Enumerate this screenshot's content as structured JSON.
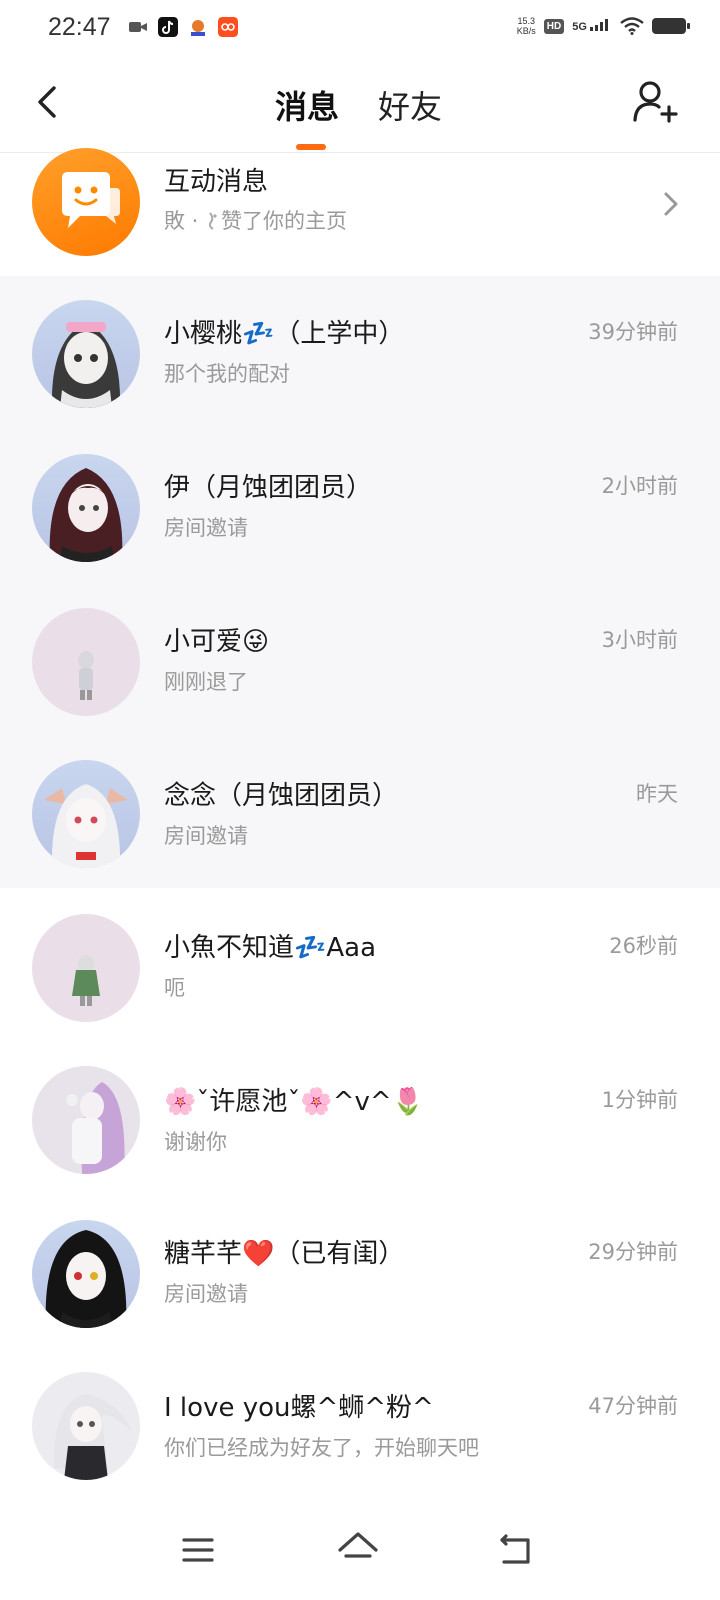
{
  "status_bar": {
    "time": "22:47",
    "net_speed_value": "15.3",
    "net_speed_unit": "KB/s",
    "hd": "HD",
    "network": "5G"
  },
  "header": {
    "tabs": [
      {
        "label": "消息",
        "active": true
      },
      {
        "label": "好友",
        "active": false
      }
    ],
    "accent_color": "#ff6a13"
  },
  "interaction": {
    "title": "互动消息",
    "preview_prefix": "敗 · ",
    "preview_suffix": "赞了你的主页"
  },
  "conversations": [
    {
      "name": "小樱桃💤（上学中）",
      "preview": "那个我的配对",
      "time": "39分钟前",
      "pinned": true
    },
    {
      "name": "伊（月蚀团团员）",
      "preview": "房间邀请",
      "time": "2小时前",
      "pinned": true
    },
    {
      "name": "小可爱😜",
      "preview": "刚刚退了",
      "time": "3小时前",
      "pinned": true
    },
    {
      "name": "念念（月蚀团团员）",
      "preview": "房间邀请",
      "time": "昨天",
      "pinned": true
    },
    {
      "name": "小魚不知道💤Aaa",
      "preview": "呃",
      "time": "26秒前",
      "pinned": false
    },
    {
      "name": "🌸ˇ许愿池ˇ🌸^v^🌷",
      "preview": "谢谢你",
      "time": "1分钟前",
      "pinned": false
    },
    {
      "name": "糖芊芊❤️（已有闺）",
      "preview": "房间邀请",
      "time": "29分钟前",
      "pinned": false
    },
    {
      "name": "I love you螺^蛳^粉^",
      "preview": "你们已经成为好友了，开始聊天吧",
      "time": "47分钟前",
      "pinned": false
    }
  ]
}
